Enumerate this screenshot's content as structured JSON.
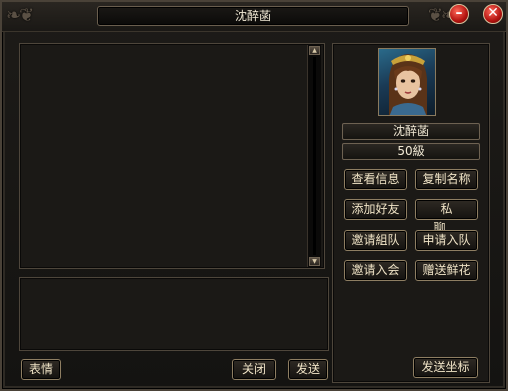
{
  "window": {
    "title": "沈醉菡"
  },
  "title_buttons": {
    "minimize": "–",
    "close": "✕"
  },
  "profile": {
    "name": "沈醉菡",
    "level": "50級"
  },
  "actions": {
    "view_info": "查看信息",
    "copy_name": "复制名称",
    "add_friend": "添加好友",
    "private_chat": "私聊",
    "invite_team": "邀请組队",
    "request_join": "申请入队",
    "invite_guild": "邀请入会",
    "send_flowers": "赠送鲜花"
  },
  "footer": {
    "emote": "表情",
    "close": "关闭",
    "send": "发送",
    "send_coords": "发送坐标"
  },
  "colors": {
    "accent_red": "#b3130f",
    "frame_gold": "#8e7e62",
    "text": "#efe3c6"
  }
}
